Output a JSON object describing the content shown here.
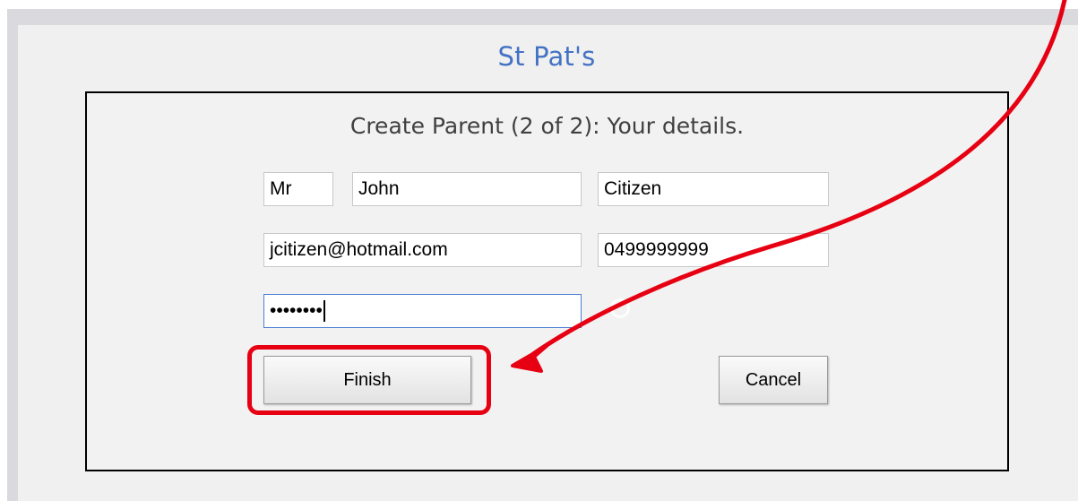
{
  "app": {
    "title": "St Pat's"
  },
  "form": {
    "heading": "Create Parent (2 of 2): Your details.",
    "fields": {
      "title_value": "Mr",
      "first_name_value": "John",
      "last_name_value": "Citizen",
      "email_value": "jcitizen@hotmail.com",
      "phone_value": "0499999999",
      "password_value": "••••••••"
    },
    "buttons": {
      "finish_label": "Finish",
      "cancel_label": "Cancel"
    }
  },
  "annotation": {
    "color": "#e60012",
    "shape": "arrow-to-highlighted-button"
  }
}
